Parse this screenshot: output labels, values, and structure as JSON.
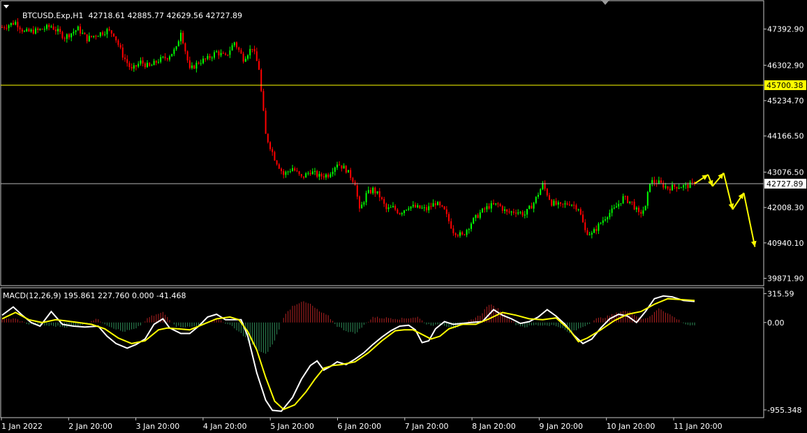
{
  "header": {
    "symbol": "BTCUSD.Exp,H1",
    "ohlc": "42718.61 42885.77 42629.56 42727.89"
  },
  "macd_header": {
    "label": "MACD(12,26,9) 195.861 227.760 0.000 -41.468"
  },
  "colors": {
    "background": "#000000",
    "bull": "#00ff00",
    "bear": "#ff0000",
    "hist_pos": "#b22222",
    "hist_neg": "#2e8b57",
    "macd_line": "#ffffff",
    "signal_line": "#ffff00",
    "level_line": "#ffff00",
    "price_line": "#b4b4b4",
    "arrow": "#ffff00",
    "grid_frame": "#c8c8c8"
  },
  "chart_data": [
    {
      "type": "candlestick",
      "title": "BTCUSD.Exp,H1",
      "y_ticks": [
        "47392.90",
        "46302.90",
        "45234.70",
        "44166.50",
        "43076.50",
        "42008.30",
        "40940.10",
        "39871.90"
      ],
      "ylim": [
        39650,
        48250
      ],
      "x_ticks": [
        "1 Jan 2022",
        "2 Jan 20:00",
        "3 Jan 20:00",
        "4 Jan 20:00",
        "5 Jan 20:00",
        "6 Jan 20:00",
        "7 Jan 20:00",
        "8 Jan 20:00",
        "9 Jan 20:00",
        "10 Jan 20:00",
        "11 Jan 20:00"
      ],
      "horizontal_level": "45700.38",
      "current_price": "42727.89",
      "close_path": [
        [
          0,
          47450
        ],
        [
          6,
          47600
        ],
        [
          10,
          47300
        ],
        [
          16,
          47350
        ],
        [
          22,
          47480
        ],
        [
          28,
          47150
        ],
        [
          34,
          47400
        ],
        [
          38,
          47100
        ],
        [
          42,
          47220
        ],
        [
          47,
          47350
        ],
        [
          50,
          47250
        ],
        [
          54,
          46600
        ],
        [
          58,
          46150
        ],
        [
          62,
          46400
        ],
        [
          66,
          46250
        ],
        [
          70,
          46450
        ],
        [
          74,
          46550
        ],
        [
          78,
          46800
        ],
        [
          80,
          47350
        ],
        [
          84,
          46150
        ],
        [
          88,
          46400
        ],
        [
          92,
          46500
        ],
        [
          96,
          46700
        ],
        [
          100,
          46550
        ],
        [
          104,
          47000
        ],
        [
          108,
          46500
        ],
        [
          112,
          46850
        ],
        [
          115,
          46200
        ],
        [
          116,
          45500
        ],
        [
          118,
          44200
        ],
        [
          122,
          43500
        ],
        [
          126,
          43000
        ],
        [
          130,
          43200
        ],
        [
          134,
          42900
        ],
        [
          138,
          43100
        ],
        [
          142,
          42950
        ],
        [
          146,
          43000
        ],
        [
          150,
          43350
        ],
        [
          154,
          43150
        ],
        [
          158,
          42750
        ],
        [
          160,
          41900
        ],
        [
          163,
          42400
        ],
        [
          166,
          42550
        ],
        [
          169,
          42350
        ],
        [
          172,
          41950
        ],
        [
          175,
          42000
        ],
        [
          178,
          41850
        ],
        [
          182,
          42050
        ],
        [
          186,
          42000
        ],
        [
          190,
          41950
        ],
        [
          194,
          42150
        ],
        [
          198,
          41900
        ],
        [
          202,
          41300
        ],
        [
          206,
          41150
        ],
        [
          210,
          41550
        ],
        [
          214,
          41850
        ],
        [
          218,
          42050
        ],
        [
          222,
          42100
        ],
        [
          226,
          41850
        ],
        [
          230,
          41900
        ],
        [
          234,
          41800
        ],
        [
          238,
          42150
        ],
        [
          242,
          42700
        ],
        [
          246,
          42150
        ],
        [
          250,
          42050
        ],
        [
          254,
          42150
        ],
        [
          258,
          42000
        ],
        [
          261,
          41300
        ],
        [
          264,
          41200
        ],
        [
          268,
          41550
        ],
        [
          271,
          41800
        ],
        [
          274,
          41950
        ],
        [
          278,
          42300
        ],
        [
          282,
          42150
        ],
        [
          285,
          41800
        ],
        [
          288,
          42000
        ],
        [
          290,
          42800
        ],
        [
          294,
          42750
        ],
        [
          298,
          42600
        ],
        [
          302,
          42650
        ],
        [
          306,
          42650
        ],
        [
          310,
          42727.89
        ]
      ],
      "forecast_path": [
        [
          310,
          42727.89
        ],
        [
          316,
          43000
        ],
        [
          318,
          42650
        ],
        [
          323,
          43050
        ],
        [
          327,
          41950
        ],
        [
          332,
          42450
        ],
        [
          337,
          40820
        ]
      ]
    },
    {
      "type": "line",
      "title": "MACD(12,26,9) 195.861 227.760 0.000 -41.468",
      "y_ticks": [
        "315.59",
        "0.00",
        "-955.348"
      ],
      "ylim": [
        -1040,
        380
      ],
      "series": [
        {
          "name": "MACD",
          "points": [
            [
              0,
              80
            ],
            [
              5,
              170
            ],
            [
              9,
              80
            ],
            [
              13,
              0
            ],
            [
              17,
              -40
            ],
            [
              22,
              120
            ],
            [
              27,
              -20
            ],
            [
              32,
              -40
            ],
            [
              37,
              -50
            ],
            [
              43,
              -40
            ],
            [
              47,
              -150
            ],
            [
              51,
              -230
            ],
            [
              56,
              -280
            ],
            [
              60,
              -240
            ],
            [
              64,
              -180
            ],
            [
              68,
              -20
            ],
            [
              72,
              40
            ],
            [
              75,
              -60
            ],
            [
              80,
              -120
            ],
            [
              84,
              -120
            ],
            [
              88,
              -40
            ],
            [
              92,
              60
            ],
            [
              96,
              90
            ],
            [
              100,
              30
            ],
            [
              104,
              30
            ],
            [
              107,
              30
            ],
            [
              110,
              -150
            ],
            [
              114,
              -550
            ],
            [
              118,
              -850
            ],
            [
              121,
              -960
            ],
            [
              125,
              -970
            ],
            [
              130,
              -820
            ],
            [
              134,
              -620
            ],
            [
              138,
              -470
            ],
            [
              141,
              -420
            ],
            [
              144,
              -520
            ],
            [
              147,
              -480
            ],
            [
              150,
              -430
            ],
            [
              154,
              -460
            ],
            [
              158,
              -400
            ],
            [
              162,
              -330
            ],
            [
              166,
              -240
            ],
            [
              170,
              -160
            ],
            [
              174,
              -90
            ],
            [
              178,
              -40
            ],
            [
              182,
              -30
            ],
            [
              185,
              -80
            ],
            [
              188,
              -220
            ],
            [
              191,
              -200
            ],
            [
              194,
              -70
            ],
            [
              198,
              10
            ],
            [
              202,
              -20
            ],
            [
              206,
              -10
            ],
            [
              210,
              0
            ],
            [
              215,
              10
            ],
            [
              220,
              140
            ],
            [
              224,
              80
            ],
            [
              228,
              40
            ],
            [
              232,
              -10
            ],
            [
              236,
              10
            ],
            [
              240,
              60
            ],
            [
              244,
              140
            ],
            [
              248,
              70
            ],
            [
              252,
              -20
            ],
            [
              256,
              -140
            ],
            [
              260,
              -230
            ],
            [
              264,
              -180
            ],
            [
              268,
              -60
            ],
            [
              272,
              40
            ],
            [
              276,
              90
            ],
            [
              280,
              70
            ],
            [
              284,
              0
            ],
            [
              288,
              120
            ],
            [
              292,
              260
            ],
            [
              296,
              290
            ],
            [
              300,
              280
            ],
            [
              305,
              240
            ],
            [
              310,
              230
            ]
          ]
        },
        {
          "name": "Signal",
          "points": [
            [
              0,
              40
            ],
            [
              6,
              110
            ],
            [
              12,
              30
            ],
            [
              18,
              0
            ],
            [
              24,
              30
            ],
            [
              28,
              20
            ],
            [
              34,
              0
            ],
            [
              40,
              -20
            ],
            [
              46,
              -70
            ],
            [
              52,
              -170
            ],
            [
              58,
              -230
            ],
            [
              64,
              -200
            ],
            [
              70,
              -80
            ],
            [
              74,
              -60
            ],
            [
              79,
              -70
            ],
            [
              84,
              -80
            ],
            [
              90,
              -20
            ],
            [
              96,
              40
            ],
            [
              102,
              60
            ],
            [
              106,
              30
            ],
            [
              110,
              -100
            ],
            [
              114,
              -300
            ],
            [
              118,
              -600
            ],
            [
              122,
              -860
            ],
            [
              126,
              -950
            ],
            [
              131,
              -900
            ],
            [
              136,
              -760
            ],
            [
              140,
              -620
            ],
            [
              144,
              -500
            ],
            [
              148,
              -470
            ],
            [
              152,
              -460
            ],
            [
              158,
              -430
            ],
            [
              164,
              -330
            ],
            [
              170,
              -200
            ],
            [
              176,
              -90
            ],
            [
              180,
              -80
            ],
            [
              184,
              -80
            ],
            [
              188,
              -130
            ],
            [
              192,
              -180
            ],
            [
              196,
              -150
            ],
            [
              200,
              -70
            ],
            [
              206,
              -20
            ],
            [
              212,
              -20
            ],
            [
              218,
              40
            ],
            [
              224,
              110
            ],
            [
              230,
              80
            ],
            [
              236,
              40
            ],
            [
              242,
              30
            ],
            [
              248,
              50
            ],
            [
              254,
              -80
            ],
            [
              258,
              -210
            ],
            [
              262,
              -170
            ],
            [
              268,
              -80
            ],
            [
              274,
              20
            ],
            [
              280,
              90
            ],
            [
              286,
              120
            ],
            [
              292,
              200
            ],
            [
              298,
              260
            ],
            [
              304,
              250
            ],
            [
              310,
              240
            ]
          ]
        }
      ],
      "histogram": [
        [
          0,
          40
        ],
        [
          6,
          40
        ],
        [
          12,
          -20
        ],
        [
          18,
          -30
        ],
        [
          24,
          -40
        ],
        [
          30,
          -50
        ],
        [
          36,
          -20
        ],
        [
          42,
          40
        ],
        [
          48,
          -40
        ],
        [
          54,
          -100
        ],
        [
          60,
          -70
        ],
        [
          66,
          60
        ],
        [
          72,
          110
        ],
        [
          78,
          -40
        ],
        [
          84,
          -50
        ],
        [
          90,
          -20
        ],
        [
          96,
          40
        ],
        [
          102,
          -30
        ],
        [
          108,
          -140
        ],
        [
          114,
          -300
        ],
        [
          118,
          -350
        ],
        [
          122,
          -200
        ],
        [
          126,
          60
        ],
        [
          130,
          180
        ],
        [
          134,
          230
        ],
        [
          138,
          200
        ],
        [
          142,
          120
        ],
        [
          146,
          70
        ],
        [
          150,
          -40
        ],
        [
          154,
          -90
        ],
        [
          158,
          -120
        ],
        [
          162,
          -30
        ],
        [
          166,
          60
        ],
        [
          170,
          50
        ],
        [
          174,
          50
        ],
        [
          178,
          40
        ],
        [
          182,
          50
        ],
        [
          186,
          60
        ],
        [
          190,
          -20
        ],
        [
          194,
          -30
        ],
        [
          198,
          -30
        ],
        [
          202,
          -60
        ],
        [
          206,
          -40
        ],
        [
          210,
          30
        ],
        [
          214,
          80
        ],
        [
          218,
          200
        ],
        [
          222,
          150
        ],
        [
          226,
          70
        ],
        [
          230,
          -20
        ],
        [
          234,
          -50
        ],
        [
          238,
          -30
        ],
        [
          242,
          -30
        ],
        [
          246,
          -30
        ],
        [
          250,
          -50
        ],
        [
          254,
          -120
        ],
        [
          258,
          -70
        ],
        [
          262,
          -20
        ],
        [
          266,
          40
        ],
        [
          270,
          60
        ],
        [
          274,
          90
        ],
        [
          278,
          130
        ],
        [
          282,
          110
        ],
        [
          286,
          40
        ],
        [
          290,
          60
        ],
        [
          294,
          160
        ],
        [
          298,
          100
        ],
        [
          302,
          40
        ],
        [
          306,
          -20
        ],
        [
          310,
          -41
        ]
      ]
    }
  ]
}
